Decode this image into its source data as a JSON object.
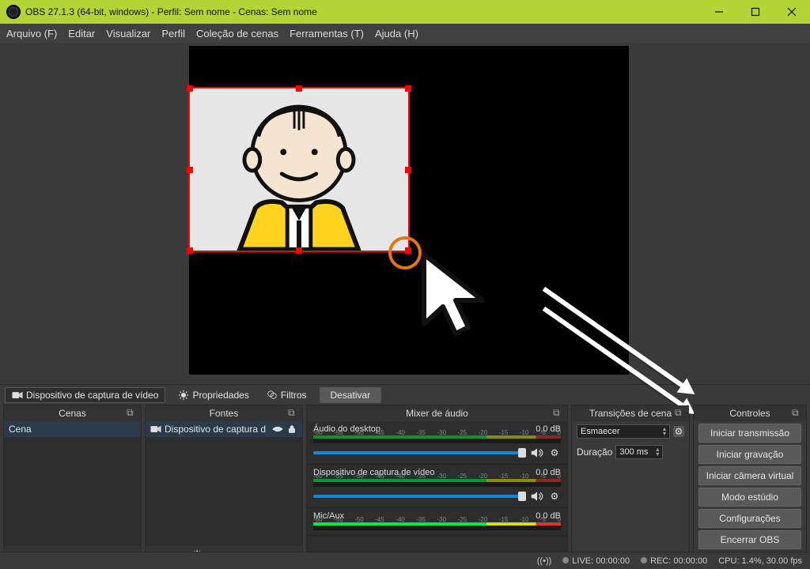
{
  "window": {
    "title": "OBS 27.1.3 (64-bit, windows) - Perfil: Sem nome - Cenas: Sem nome"
  },
  "menu": {
    "file": "Arquivo (F)",
    "edit": "Editar",
    "view": "Visualizar",
    "profile": "Perfil",
    "scene_collection": "Coleção de cenas",
    "tools": "Ferramentas (T)",
    "help": "Ajuda (H)"
  },
  "source_toolbar": {
    "source_name": "Dispositivo de captura de vídeo",
    "properties": "Propriedades",
    "filters": "Filtros",
    "deactivate": "Desativar"
  },
  "panels": {
    "scenes": {
      "title": "Cenas",
      "items": [
        "Cena"
      ]
    },
    "sources": {
      "title": "Fontes",
      "items": [
        "Dispositivo de captura d"
      ]
    },
    "mixer": {
      "title": "Mixer de áudio",
      "ticks": [
        "-60",
        "-55",
        "-50",
        "-45",
        "-40",
        "-35",
        "-30",
        "-25",
        "-20",
        "-15",
        "-10",
        "-5",
        "0"
      ],
      "tracks": [
        {
          "name": "Áudio do desktop",
          "level": "0.0 dB"
        },
        {
          "name": "Dispositivo de captura de vídeo",
          "level": "0.0 dB"
        },
        {
          "name": "Mic/Aux",
          "level": "0.0 dB"
        }
      ]
    },
    "transitions": {
      "title": "Transições de cena",
      "selected": "Esmaecer",
      "duration_label": "Duração",
      "duration_value": "300 ms"
    },
    "controls": {
      "title": "Controles",
      "buttons": {
        "stream": "Iniciar transmissão",
        "record": "Iniciar gravação",
        "vcam": "Iniciar câmera virtual",
        "studio": "Modo estúdio",
        "settings": "Configurações",
        "exit": "Encerrar OBS"
      }
    }
  },
  "statusbar": {
    "live": "LIVE: 00:00:00",
    "rec": "REC: 00:00:00",
    "cpu": "CPU: 1.4%, 30.00 fps"
  }
}
